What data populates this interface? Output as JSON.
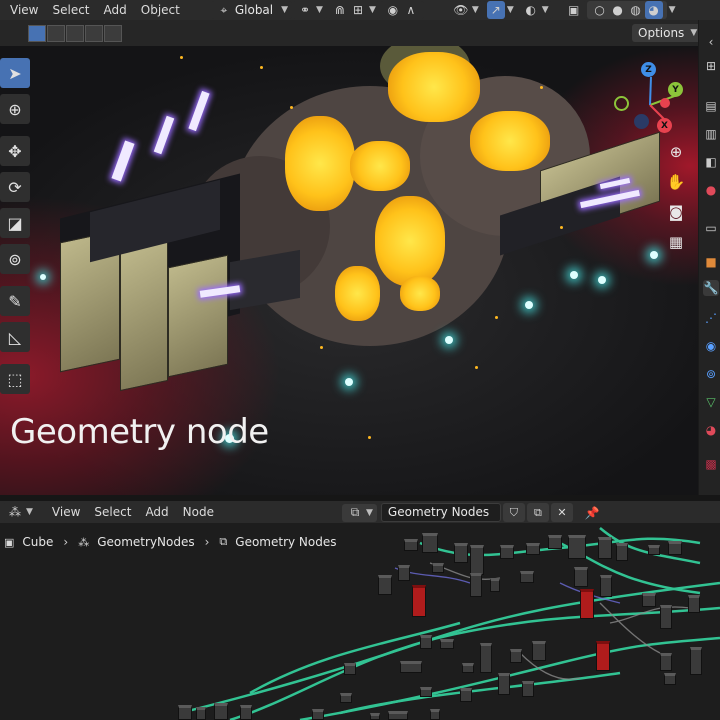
{
  "viewport_header": {
    "menus": [
      "View",
      "Select",
      "Add",
      "Object"
    ],
    "orientation": "Global",
    "icons": [
      "transform-orientation-icon",
      "pivot-icon",
      "snap-icon",
      "proportional-edit-icon",
      "visibility-icon",
      "gizmo-icon",
      "overlay-icon",
      "shading-icon"
    ]
  },
  "tool_row": {
    "options_label": "Options"
  },
  "viewport": {
    "caption": "Geometry node"
  },
  "gizmo": {
    "x": "X",
    "y": "Y",
    "z": "Z"
  },
  "node_editor": {
    "menus": [
      "View",
      "Select",
      "Add",
      "Node"
    ],
    "node_tree_name": "Geometry Nodes",
    "breadcrumb": [
      "Cube",
      "GeometryNodes",
      "Geometry Nodes"
    ]
  },
  "colors": {
    "accent": "#4772b3",
    "header_bg": "#2b2b2b",
    "link_green": "#35d5a0",
    "node_red": "#b01c1c"
  }
}
